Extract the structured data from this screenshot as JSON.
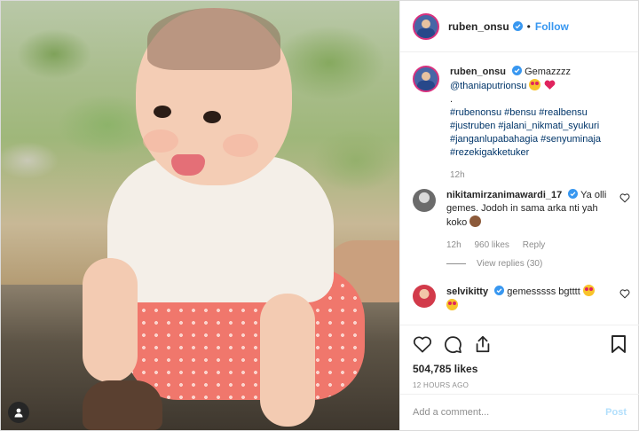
{
  "header": {
    "username": "ruben_onsu",
    "separator": "•",
    "follow_label": "Follow"
  },
  "caption": {
    "username": "ruben_onsu",
    "text": "Gemazzzz",
    "mention": "@thaniaputrionsu",
    "dot": ".",
    "hashtags": "#rubenonsu #bensu #realbensu #justruben #jalani_nikmati_syukuri #janganlupabahagia #senyuminaja #rezekigakketuker",
    "time": "12h"
  },
  "comments": [
    {
      "username": "nikitamirzanimawardi_17",
      "text": "Ya olli gemes. Jodoh in sama arka nti yah koko",
      "time": "12h",
      "likes": "960 likes",
      "reply_label": "Reply",
      "view_replies": "View replies (30)"
    },
    {
      "username": "selvikitty",
      "text": "gemesssss bgtttt"
    }
  ],
  "stats": {
    "likes": "504,785 likes",
    "posted": "12 HOURS AGO"
  },
  "composer": {
    "placeholder": "Add a comment...",
    "post_label": "Post"
  },
  "icons": {
    "heart": "heart-icon",
    "comment": "comment-icon",
    "share": "share-icon",
    "save": "bookmark-icon",
    "verified": "verified-badge-icon",
    "user_tag": "user-tag-icon"
  },
  "colors": {
    "link_blue": "#3897f0",
    "mention_blue": "#003569",
    "muted": "#8e8e8e",
    "verified": "#3897f0",
    "post_disabled": "#b2dffc"
  }
}
